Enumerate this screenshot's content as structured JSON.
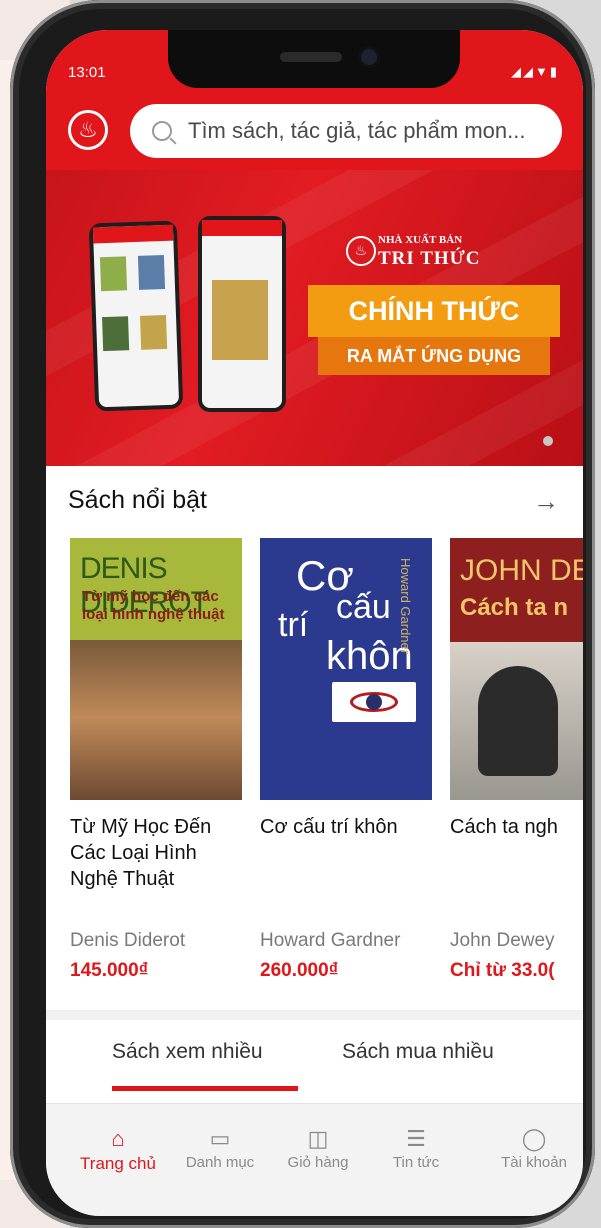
{
  "status_bar": {
    "time": "13:01"
  },
  "search": {
    "placeholder": "Tìm sách, tác giả, tác phẩm mon..."
  },
  "banner": {
    "publisher_small": "NHÀ XUẤT BẢN",
    "publisher_main": "TRI THỨC",
    "headline_1": "CHÍNH THỨC",
    "headline_2": "RA MẮT ỨNG DỤNG"
  },
  "featured": {
    "title": "Sách nổi bật",
    "books": [
      {
        "cover_author": "DENIS DIDEROT",
        "cover_title": "Từ mỹ học đến các loại hình nghệ thuật",
        "title": "Từ Mỹ Học Đến Các Loại Hình Nghệ Thuật",
        "author": "Denis Diderot",
        "price": "145.000₫"
      },
      {
        "cover_title_1": "Cơ",
        "cover_title_2": "cấu",
        "cover_title_3": "trí",
        "cover_title_4": "khôn",
        "cover_author": "Howard Gardner",
        "title": "Cơ cấu trí khôn",
        "author": "Howard Gardner",
        "price": "260.000₫"
      },
      {
        "cover_author": "JOHN DEW",
        "cover_title": "Cách ta n",
        "title": "Cách ta ngh",
        "author": "John Dewey",
        "price": "Chỉ từ 33.0("
      }
    ]
  },
  "tabs": [
    "Sách xem nhiều",
    "Sách mua nhiều"
  ],
  "bottom_nav": [
    "Trang chủ",
    "Danh mục",
    "Giỏ hàng",
    "Tin tức",
    "Tài khoản"
  ],
  "colors": {
    "brand": "#e0161b",
    "accent_orange": "#f39c12"
  }
}
